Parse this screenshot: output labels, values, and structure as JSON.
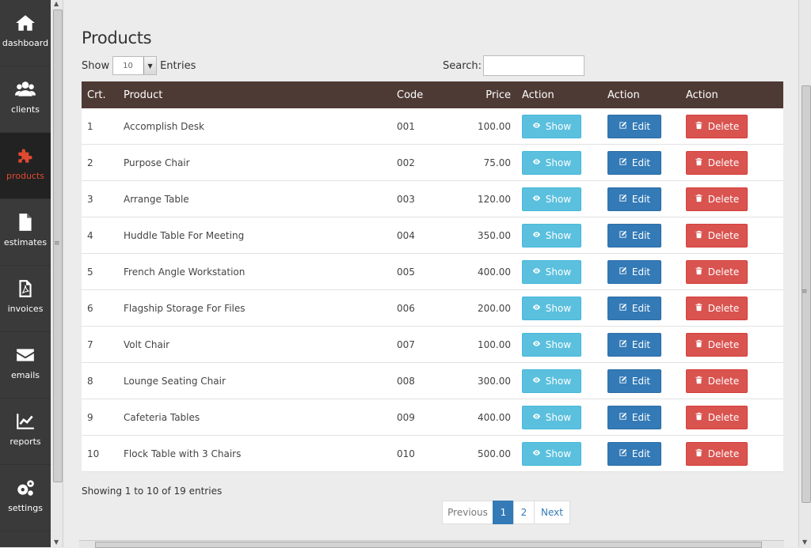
{
  "sidebar": {
    "items": [
      {
        "label": "dashboard",
        "icon": "home-icon"
      },
      {
        "label": "clients",
        "icon": "users-icon"
      },
      {
        "label": "products",
        "icon": "puzzle-icon",
        "active": true
      },
      {
        "label": "estimates",
        "icon": "file-icon"
      },
      {
        "label": "invoices",
        "icon": "pdf-icon"
      },
      {
        "label": "emails",
        "icon": "envelope-icon"
      },
      {
        "label": "reports",
        "icon": "chart-line-icon"
      },
      {
        "label": "settings",
        "icon": "gears-icon"
      }
    ],
    "active_color": "#e0492f"
  },
  "page": {
    "title": "Products",
    "show_label": "Show",
    "entries_label": "Entries",
    "page_length": "10",
    "search_label": "Search:",
    "search_value": ""
  },
  "table": {
    "header_color": "#4e3a34",
    "columns": [
      "Crt.",
      "Product",
      "Code",
      "Price",
      "Action",
      "Action",
      "Action"
    ],
    "rows": [
      {
        "crt": "1",
        "product": "Accomplish Desk",
        "code": "001",
        "price": "100.00"
      },
      {
        "crt": "2",
        "product": "Purpose Chair",
        "code": "002",
        "price": "75.00"
      },
      {
        "crt": "3",
        "product": "Arrange Table",
        "code": "003",
        "price": "120.00"
      },
      {
        "crt": "4",
        "product": "Huddle Table For Meeting",
        "code": "004",
        "price": "350.00"
      },
      {
        "crt": "5",
        "product": "French Angle Workstation",
        "code": "005",
        "price": "400.00"
      },
      {
        "crt": "6",
        "product": "Flagship Storage For Files",
        "code": "006",
        "price": "200.00"
      },
      {
        "crt": "7",
        "product": "Volt Chair",
        "code": "007",
        "price": "100.00"
      },
      {
        "crt": "8",
        "product": "Lounge Seating Chair",
        "code": "008",
        "price": "300.00"
      },
      {
        "crt": "9",
        "product": "Cafeteria Tables",
        "code": "009",
        "price": "400.00"
      },
      {
        "crt": "10",
        "product": "Flock Table with 3 Chairs",
        "code": "010",
        "price": "500.00"
      }
    ],
    "actions": {
      "show": "Show",
      "edit": "Edit",
      "delete": "Delete"
    }
  },
  "footer": {
    "info": "Showing 1 to 10 of 19 entries",
    "pagination": {
      "previous": "Previous",
      "pages": [
        "1",
        "2"
      ],
      "next": "Next",
      "current": "1"
    }
  }
}
